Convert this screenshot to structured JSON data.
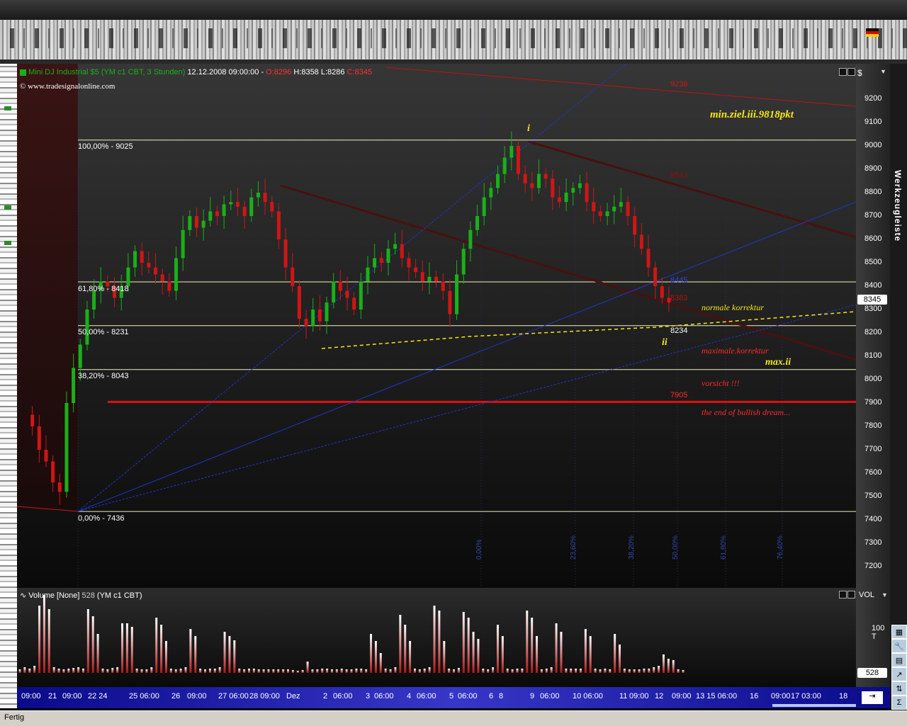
{
  "header": {
    "instrument": "Mini DJ Industrial $5 (YM c1 CBT, 3 Stunden)",
    "datetime": "12.12.2008 09:00:00",
    "open": "O:8296",
    "high": "H:8358",
    "low": "L:8286",
    "close": "C:8345",
    "copyright": "© www.tradesignalonline.com"
  },
  "price_axis": {
    "currency": "$",
    "ticks": [
      "9200",
      "9100",
      "9000",
      "8900",
      "8800",
      "8700",
      "8600",
      "8500",
      "8400",
      "8300",
      "8200",
      "8100",
      "8000",
      "7900",
      "7800",
      "7700",
      "7600",
      "7500",
      "7400",
      "7300",
      "7200"
    ],
    "last_price": "8345",
    "toolbar_label": "Werkzeugleiste"
  },
  "fibonacci": [
    {
      "label": "100,00% - 9025"
    },
    {
      "label": "61,80% - 8418"
    },
    {
      "label": "50,00% - 8231"
    },
    {
      "label": "38,20% - 8043"
    },
    {
      "label": "0,00% - 7436"
    }
  ],
  "levels": {
    "top_red": "9238",
    "mid_red": "8543",
    "blue1": "8445",
    "red2": "8383",
    "support": "8234",
    "bottom_red": "7905"
  },
  "wave_labels": {
    "i": "i",
    "ii": "ii"
  },
  "annotations": {
    "min_target": "min.ziel.iii.9818pkt",
    "normal": "normale korrektur",
    "maximal": "maximale.korrektur",
    "max_ii": "max.ii",
    "caution": "vorsicht !!!",
    "end": "the end of bullish dream..."
  },
  "time_fibs": [
    "0,00%",
    "23,60%",
    "38,20%",
    "50,00%",
    "61,80%",
    "76,40%"
  ],
  "volume_panel": {
    "title": "Volume [None]",
    "value": "528",
    "symbol": "(YM c1 CBT)",
    "axis_label": "VOL",
    "tick": "100 T",
    "last": "528"
  },
  "time_axis": [
    "09:00",
    "21",
    "09:00",
    "22 24",
    "25 06:00",
    "26",
    "09:00",
    "27 06:00",
    "28 09:00",
    "Dez",
    "2",
    "06:00",
    "3",
    "06:00",
    "4",
    "06:00",
    "5",
    "06:00",
    "6",
    "8",
    "9",
    "06:00",
    "10 06:00",
    "11",
    "09:00",
    "12",
    "09:00",
    "13 15 06:00",
    "16",
    "09:00",
    "17 03:00",
    "18"
  ],
  "status": "Fertig",
  "colors": {
    "up": "#19b019",
    "down": "#d01515",
    "fib": "#f0f0c0",
    "annotation_yellow": "#f5e61a",
    "annotation_red": "#ff2a2a"
  }
}
